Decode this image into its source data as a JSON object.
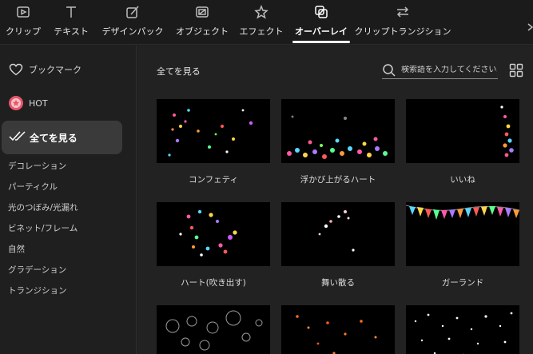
{
  "tabs": [
    {
      "label": "クリップ",
      "icon": "play-clip-icon"
    },
    {
      "label": "テキスト",
      "icon": "text-icon"
    },
    {
      "label": "デザインパック",
      "icon": "design-pack-icon"
    },
    {
      "label": "オブジェクト",
      "icon": "object-icon"
    },
    {
      "label": "エフェクト",
      "icon": "effect-star-icon"
    },
    {
      "label": "オーバーレイ",
      "icon": "overlay-icon"
    },
    {
      "label": "クリップトランジション",
      "icon": "transition-arrows-icon"
    }
  ],
  "active_tab_index": 5,
  "sidebar": {
    "bookmark": "ブックマーク",
    "hot": "HOT",
    "active": "全てを見る",
    "categories": [
      "デコレーション",
      "パーティクル",
      "光のつぼみ/光漏れ",
      "ビネット/フレーム",
      "自然",
      "グラデーション",
      "トランジション"
    ]
  },
  "main": {
    "title": "全てを見る",
    "search_placeholder": "検索語を入力してください。",
    "items": [
      {
        "label": "コンフェティ"
      },
      {
        "label": "浮かび上がるハート"
      },
      {
        "label": "いいね"
      },
      {
        "label": "ハート(吹き出す)"
      },
      {
        "label": "舞い散る"
      },
      {
        "label": "ガーランド"
      },
      {
        "label": ""
      },
      {
        "label": ""
      },
      {
        "label": ""
      }
    ]
  },
  "colors": {
    "background": "#1f1f1f",
    "toolbar": "#1b1b1b",
    "active_item": "#3a3a3a",
    "hot_badge": "#e8566a"
  }
}
